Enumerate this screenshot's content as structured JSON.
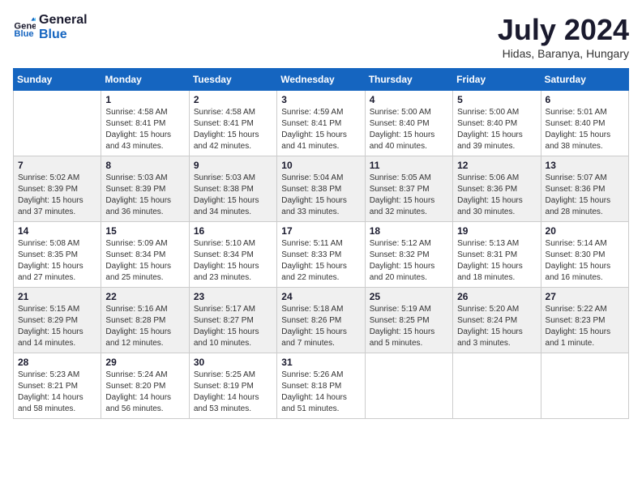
{
  "header": {
    "logo_general": "General",
    "logo_blue": "Blue",
    "month_year": "July 2024",
    "location": "Hidas, Baranya, Hungary"
  },
  "weekdays": [
    "Sunday",
    "Monday",
    "Tuesday",
    "Wednesday",
    "Thursday",
    "Friday",
    "Saturday"
  ],
  "weeks": [
    [
      {
        "day": "",
        "sunrise": "",
        "sunset": "",
        "daylight": ""
      },
      {
        "day": "1",
        "sunrise": "Sunrise: 4:58 AM",
        "sunset": "Sunset: 8:41 PM",
        "daylight": "Daylight: 15 hours and 43 minutes."
      },
      {
        "day": "2",
        "sunrise": "Sunrise: 4:58 AM",
        "sunset": "Sunset: 8:41 PM",
        "daylight": "Daylight: 15 hours and 42 minutes."
      },
      {
        "day": "3",
        "sunrise": "Sunrise: 4:59 AM",
        "sunset": "Sunset: 8:41 PM",
        "daylight": "Daylight: 15 hours and 41 minutes."
      },
      {
        "day": "4",
        "sunrise": "Sunrise: 5:00 AM",
        "sunset": "Sunset: 8:40 PM",
        "daylight": "Daylight: 15 hours and 40 minutes."
      },
      {
        "day": "5",
        "sunrise": "Sunrise: 5:00 AM",
        "sunset": "Sunset: 8:40 PM",
        "daylight": "Daylight: 15 hours and 39 minutes."
      },
      {
        "day": "6",
        "sunrise": "Sunrise: 5:01 AM",
        "sunset": "Sunset: 8:40 PM",
        "daylight": "Daylight: 15 hours and 38 minutes."
      }
    ],
    [
      {
        "day": "7",
        "sunrise": "Sunrise: 5:02 AM",
        "sunset": "Sunset: 8:39 PM",
        "daylight": "Daylight: 15 hours and 37 minutes."
      },
      {
        "day": "8",
        "sunrise": "Sunrise: 5:03 AM",
        "sunset": "Sunset: 8:39 PM",
        "daylight": "Daylight: 15 hours and 36 minutes."
      },
      {
        "day": "9",
        "sunrise": "Sunrise: 5:03 AM",
        "sunset": "Sunset: 8:38 PM",
        "daylight": "Daylight: 15 hours and 34 minutes."
      },
      {
        "day": "10",
        "sunrise": "Sunrise: 5:04 AM",
        "sunset": "Sunset: 8:38 PM",
        "daylight": "Daylight: 15 hours and 33 minutes."
      },
      {
        "day": "11",
        "sunrise": "Sunrise: 5:05 AM",
        "sunset": "Sunset: 8:37 PM",
        "daylight": "Daylight: 15 hours and 32 minutes."
      },
      {
        "day": "12",
        "sunrise": "Sunrise: 5:06 AM",
        "sunset": "Sunset: 8:36 PM",
        "daylight": "Daylight: 15 hours and 30 minutes."
      },
      {
        "day": "13",
        "sunrise": "Sunrise: 5:07 AM",
        "sunset": "Sunset: 8:36 PM",
        "daylight": "Daylight: 15 hours and 28 minutes."
      }
    ],
    [
      {
        "day": "14",
        "sunrise": "Sunrise: 5:08 AM",
        "sunset": "Sunset: 8:35 PM",
        "daylight": "Daylight: 15 hours and 27 minutes."
      },
      {
        "day": "15",
        "sunrise": "Sunrise: 5:09 AM",
        "sunset": "Sunset: 8:34 PM",
        "daylight": "Daylight: 15 hours and 25 minutes."
      },
      {
        "day": "16",
        "sunrise": "Sunrise: 5:10 AM",
        "sunset": "Sunset: 8:34 PM",
        "daylight": "Daylight: 15 hours and 23 minutes."
      },
      {
        "day": "17",
        "sunrise": "Sunrise: 5:11 AM",
        "sunset": "Sunset: 8:33 PM",
        "daylight": "Daylight: 15 hours and 22 minutes."
      },
      {
        "day": "18",
        "sunrise": "Sunrise: 5:12 AM",
        "sunset": "Sunset: 8:32 PM",
        "daylight": "Daylight: 15 hours and 20 minutes."
      },
      {
        "day": "19",
        "sunrise": "Sunrise: 5:13 AM",
        "sunset": "Sunset: 8:31 PM",
        "daylight": "Daylight: 15 hours and 18 minutes."
      },
      {
        "day": "20",
        "sunrise": "Sunrise: 5:14 AM",
        "sunset": "Sunset: 8:30 PM",
        "daylight": "Daylight: 15 hours and 16 minutes."
      }
    ],
    [
      {
        "day": "21",
        "sunrise": "Sunrise: 5:15 AM",
        "sunset": "Sunset: 8:29 PM",
        "daylight": "Daylight: 15 hours and 14 minutes."
      },
      {
        "day": "22",
        "sunrise": "Sunrise: 5:16 AM",
        "sunset": "Sunset: 8:28 PM",
        "daylight": "Daylight: 15 hours and 12 minutes."
      },
      {
        "day": "23",
        "sunrise": "Sunrise: 5:17 AM",
        "sunset": "Sunset: 8:27 PM",
        "daylight": "Daylight: 15 hours and 10 minutes."
      },
      {
        "day": "24",
        "sunrise": "Sunrise: 5:18 AM",
        "sunset": "Sunset: 8:26 PM",
        "daylight": "Daylight: 15 hours and 7 minutes."
      },
      {
        "day": "25",
        "sunrise": "Sunrise: 5:19 AM",
        "sunset": "Sunset: 8:25 PM",
        "daylight": "Daylight: 15 hours and 5 minutes."
      },
      {
        "day": "26",
        "sunrise": "Sunrise: 5:20 AM",
        "sunset": "Sunset: 8:24 PM",
        "daylight": "Daylight: 15 hours and 3 minutes."
      },
      {
        "day": "27",
        "sunrise": "Sunrise: 5:22 AM",
        "sunset": "Sunset: 8:23 PM",
        "daylight": "Daylight: 15 hours and 1 minute."
      }
    ],
    [
      {
        "day": "28",
        "sunrise": "Sunrise: 5:23 AM",
        "sunset": "Sunset: 8:21 PM",
        "daylight": "Daylight: 14 hours and 58 minutes."
      },
      {
        "day": "29",
        "sunrise": "Sunrise: 5:24 AM",
        "sunset": "Sunset: 8:20 PM",
        "daylight": "Daylight: 14 hours and 56 minutes."
      },
      {
        "day": "30",
        "sunrise": "Sunrise: 5:25 AM",
        "sunset": "Sunset: 8:19 PM",
        "daylight": "Daylight: 14 hours and 53 minutes."
      },
      {
        "day": "31",
        "sunrise": "Sunrise: 5:26 AM",
        "sunset": "Sunset: 8:18 PM",
        "daylight": "Daylight: 14 hours and 51 minutes."
      },
      {
        "day": "",
        "sunrise": "",
        "sunset": "",
        "daylight": ""
      },
      {
        "day": "",
        "sunrise": "",
        "sunset": "",
        "daylight": ""
      },
      {
        "day": "",
        "sunrise": "",
        "sunset": "",
        "daylight": ""
      }
    ]
  ]
}
